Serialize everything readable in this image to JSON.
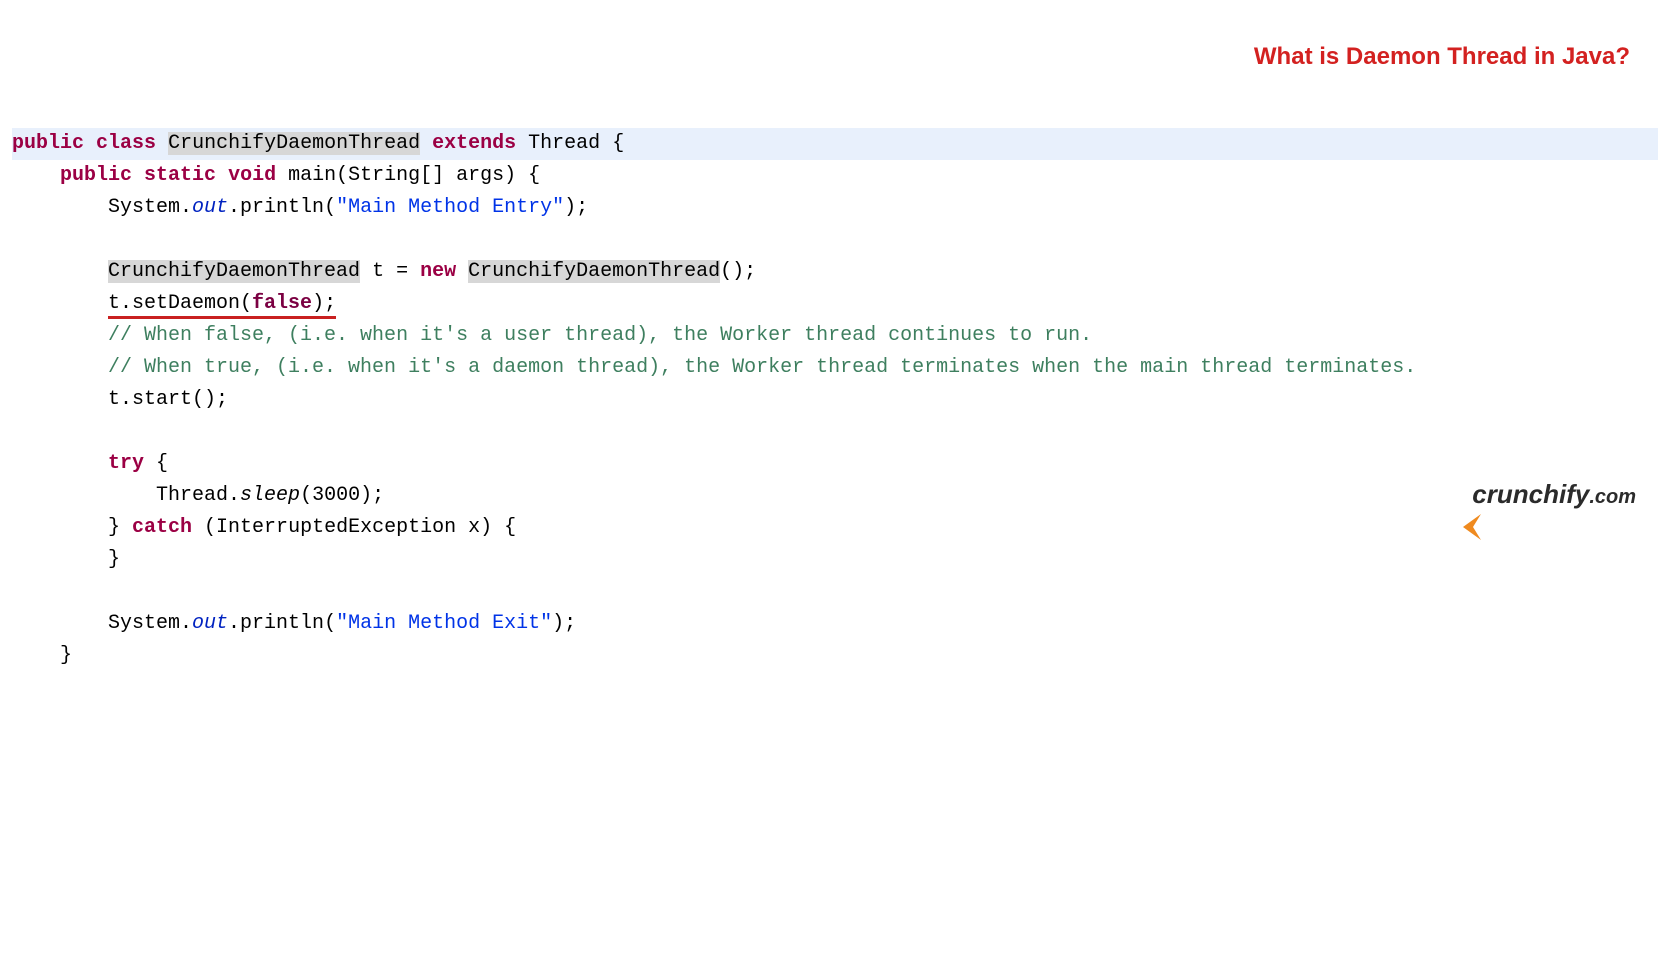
{
  "code": {
    "kw_public": "public",
    "kw_class": "class",
    "classname": "CrunchifyDaemonThread",
    "kw_extends": "extends",
    "classname_thread": "Thread",
    "brace_open": "{",
    "kw_static": "static",
    "kw_void": "void",
    "main_sig": "main(String[] args) {",
    "sys": "System.",
    "out": "out",
    "println": ".println(",
    "str1": "\"Main Method Entry\"",
    "close_call": ");",
    "var_t": " t = ",
    "kw_new": "new",
    "ctor_close": "();",
    "setdaemon_pre": "t.setDaemon(",
    "kw_false": "false",
    "setdaemon_post": ");",
    "comment1": "// When false, (i.e. when it's a user thread), the Worker thread continues to run.",
    "comment2": "// When true, (i.e. when it's a daemon thread), the Worker thread terminates when the main thread terminates.",
    "start_call": "t.start();",
    "kw_try": "try",
    "brace_open2": " {",
    "thread_sleep_pre": "Thread.",
    "sleep": "sleep",
    "sleep_arg": "(3000);",
    "brace_close": "} ",
    "kw_catch": "catch",
    "catch_arg": " (InterruptedException x) {",
    "brace_close_only": "}",
    "str2": "\"Main Method Exit\"",
    "indent1": "    ",
    "indent2": "        ",
    "indent3": "            "
  },
  "annotation": {
    "title": "What is Daemon Thread in Java?"
  },
  "logo": {
    "brand": "crunchify",
    "domain": ".com"
  }
}
